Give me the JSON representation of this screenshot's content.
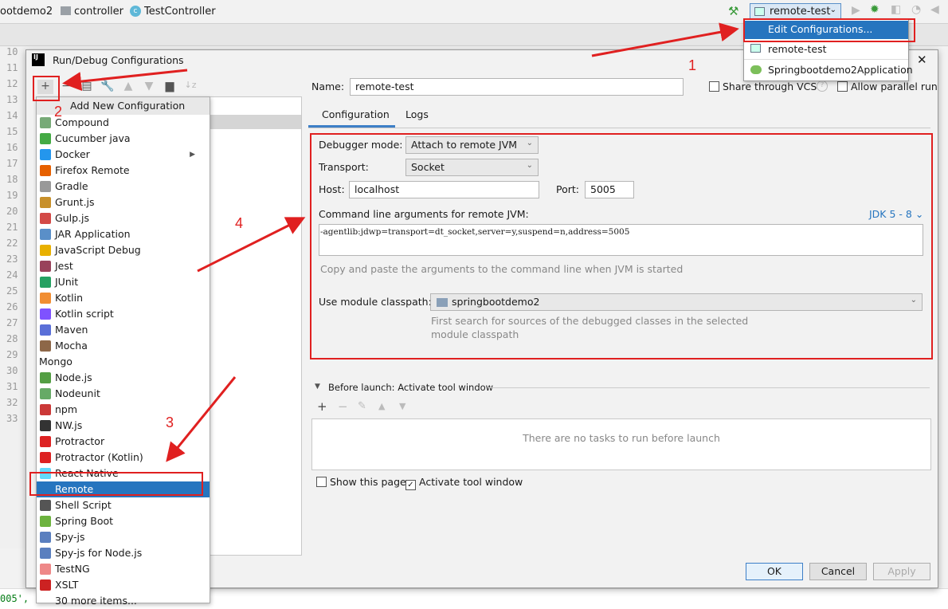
{
  "breadcrumb": [
    "ootdemo2",
    "controller",
    "TestController"
  ],
  "run_config_selector": "remote-test",
  "run_menu": {
    "items": [
      "Edit Configurations...",
      "remote-test",
      "Springbootdemo2Application"
    ]
  },
  "line_numbers": [
    "10",
    "11",
    "12",
    "13",
    "14",
    "15",
    "16",
    "17",
    "18",
    "19",
    "20",
    "21",
    "22",
    "23",
    "24",
    "25",
    "26",
    "27",
    "28",
    "29",
    "30",
    "31",
    "32",
    "33"
  ],
  "editor_fragment": "005',",
  "dialog": {
    "title": "Run/Debug Configurations",
    "popup": {
      "header": "Add New Configuration",
      "items": [
        "Compound",
        "Cucumber java",
        "Docker",
        "Firefox Remote",
        "Gradle",
        "Grunt.js",
        "Gulp.js",
        "JAR Application",
        "JavaScript Debug",
        "Jest",
        "JUnit",
        "Kotlin",
        "Kotlin script",
        "Maven",
        "Mocha",
        "Mongo",
        "Node.js",
        "Nodeunit",
        "npm",
        "NW.js",
        "Protractor",
        "Protractor (Kotlin)",
        "React Native",
        "Remote",
        "Shell Script",
        "Spring Boot",
        "Spy-js",
        "Spy-js for Node.js",
        "TestNG",
        "XSLT",
        "30 more items..."
      ],
      "selected": "Remote"
    },
    "name_label": "Name:",
    "name_value": "remote-test",
    "share_vcs": "Share through VCS",
    "allow_parallel": "Allow parallel run",
    "tabs": [
      "Configuration",
      "Logs"
    ],
    "active_tab": "Configuration",
    "debugger_mode_label": "Debugger mode:",
    "debugger_mode": "Attach to remote JVM",
    "transport_label": "Transport:",
    "transport": "Socket",
    "host_label": "Host:",
    "host": "localhost",
    "port_label": "Port:",
    "port": "5005",
    "cmd_label": "Command line arguments for remote JVM:",
    "jdk": "JDK 5 - 8",
    "cmd_value": "-agentlib:jdwp=transport=dt_socket,server=y,suspend=n,address=5005",
    "cmd_hint": "Copy and paste the arguments to the command line when JVM is started",
    "module_label": "Use module classpath:",
    "module": "springbootdemo2",
    "module_hint1": "First search for sources of the debugged classes in the selected",
    "module_hint2": "module classpath",
    "before_launch": "Before launch: Activate tool window",
    "no_tasks": "There are no tasks to run before launch",
    "show_page": "Show this page",
    "activate_tool": "Activate tool window",
    "ok": "OK",
    "cancel": "Cancel",
    "apply": "Apply"
  },
  "annotations": [
    "1",
    "2",
    "3",
    "4"
  ],
  "colors": {
    "accent": "#2675bf",
    "annotation": "#e02020",
    "link": "#2675bf"
  }
}
